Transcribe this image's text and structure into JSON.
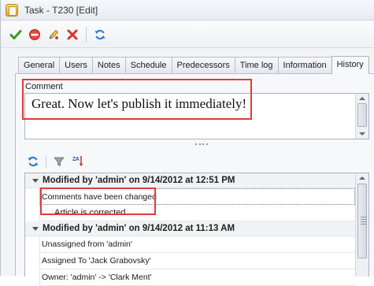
{
  "window": {
    "title": "Task - T230 [Edit]"
  },
  "toolbar": {
    "buttons": [
      {
        "name": "save-button",
        "icon": "check-icon",
        "color": "#3a9a1e"
      },
      {
        "name": "cancel-button",
        "icon": "no-entry-icon",
        "color": "#d9312b"
      },
      {
        "name": "edit-button",
        "icon": "pencil-icon",
        "color": "#3f7fd0"
      },
      {
        "name": "delete-button",
        "icon": "x-icon",
        "color": "#d9312b"
      },
      {
        "name": "refresh-button",
        "icon": "refresh-icon",
        "color": "#2f7fd1"
      }
    ]
  },
  "tabs": [
    "General",
    "Users",
    "Notes",
    "Schedule",
    "Predecessors",
    "Time log",
    "Information",
    "History"
  ],
  "active_tab": "History",
  "comment": {
    "label": "Comment",
    "value": "Great. Now let's publish it immediately!"
  },
  "history_toolbar": {
    "buttons": [
      {
        "name": "refresh-button",
        "icon": "refresh-icon"
      },
      {
        "name": "filter-button",
        "icon": "funnel-icon"
      },
      {
        "name": "sort-button",
        "icon": "sort-za-icon",
        "text": "ZA"
      }
    ]
  },
  "history": {
    "groups": [
      {
        "header": "Modified by 'admin' on 9/14/2012 at 12:51 PM",
        "rows": [
          {
            "text": "Comments have been changed",
            "indent": false,
            "focused": true
          },
          {
            "text": "Article is corrected",
            "indent": true,
            "focused": false
          }
        ]
      },
      {
        "header": "Modified by 'admin' on 9/14/2012 at 11:13 AM",
        "rows": [
          {
            "text": "Unassigned from 'admin'",
            "indent": false,
            "focused": false
          },
          {
            "text": "Assigned To 'Jack Grabovsky'",
            "indent": false,
            "focused": false
          },
          {
            "text": "Owner: 'admin' -> 'Clark Ment'",
            "indent": false,
            "focused": false
          }
        ]
      }
    ]
  },
  "colors": {
    "highlight_outline": "#e23a3a",
    "accent": "#2f7fd1"
  }
}
